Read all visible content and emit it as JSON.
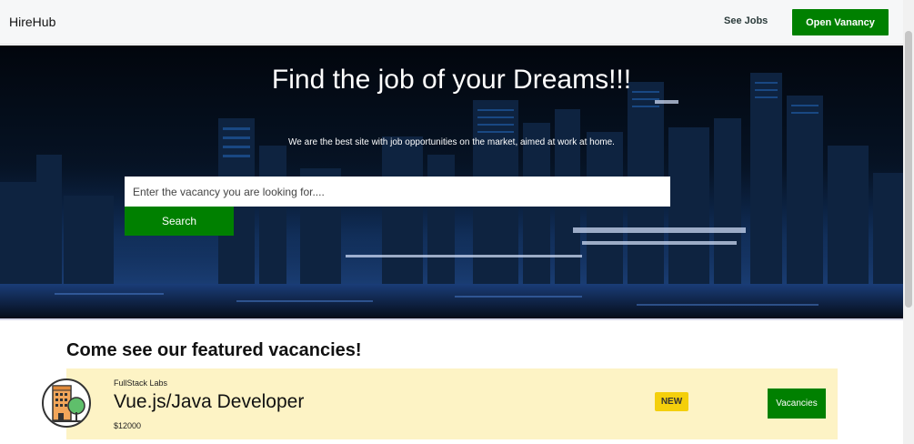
{
  "navbar": {
    "brand": "HireHub",
    "see_jobs": "See Jobs",
    "open_vacancy": "Open Vanancy"
  },
  "hero": {
    "title": "Find the job of your Dreams!!!",
    "subtitle": "We are the best site with job opportunities on the market, aimed at work at home.",
    "search_placeholder": "Enter the vacancy you are looking for....",
    "search_button": "Search"
  },
  "featured": {
    "heading": "Come see our featured vacancies!",
    "vacancies": [
      {
        "company": "FullStack Labs",
        "title": "Vue.js/Java Developer",
        "salary": "$12000",
        "badge": "NEW",
        "button": "Vacancies",
        "logo_icon": "building-tree-icon"
      }
    ]
  },
  "colors": {
    "accent": "#008000",
    "card_background": "#fdf3c5",
    "badge": "#f4cf0c"
  }
}
